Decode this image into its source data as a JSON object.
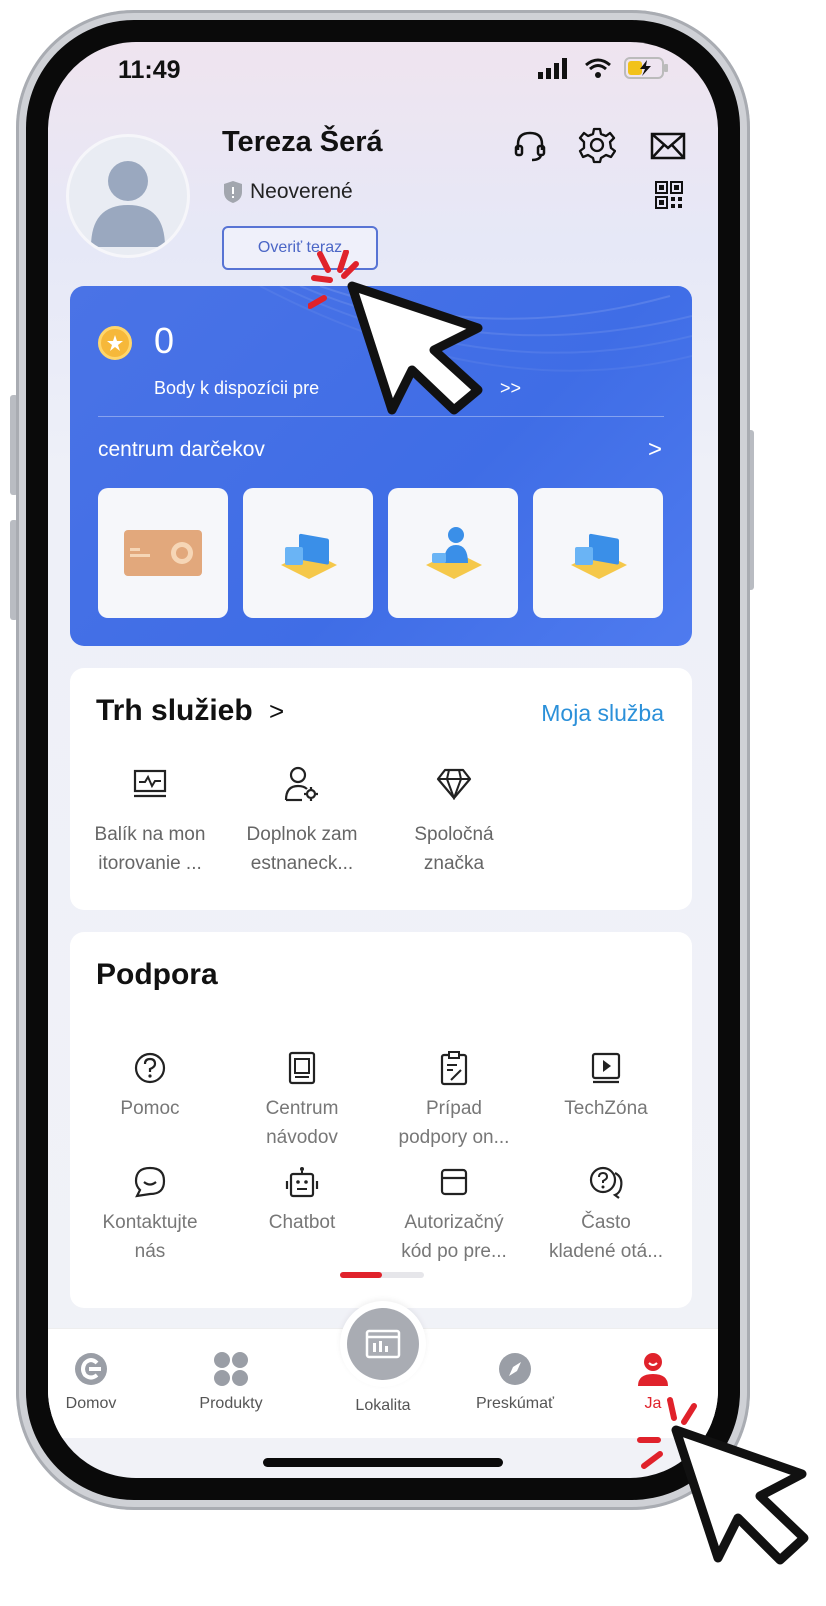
{
  "status_bar": {
    "time": "11:49"
  },
  "profile": {
    "name": "Tereza Šerá",
    "verification_status": "Neoverené",
    "verify_button_label": "Overiť teraz"
  },
  "header_icons": [
    "headset-icon",
    "gear-icon",
    "mail-icon",
    "qr-code-icon"
  ],
  "points": {
    "value": "0",
    "description": "Body k dispozícii pre",
    "more": ">>"
  },
  "gift_center": {
    "title": "centrum darčekov",
    "chevron": ">",
    "tiles": [
      "gift-card-image",
      "device-package-image",
      "person-package-image",
      "device-package-image"
    ]
  },
  "service_market": {
    "title": "Trh služieb",
    "title_chevron": ">",
    "link": "Moja služba",
    "items": [
      {
        "icon": "monitor-chart-icon",
        "line1": "Balík na mon",
        "line2": "itorovanie ..."
      },
      {
        "icon": "user-gear-icon",
        "line1": "Doplnok zam",
        "line2": "estnaneck..."
      },
      {
        "icon": "diamond-icon",
        "line1": "Spoločná",
        "line2": "značka"
      }
    ]
  },
  "support": {
    "title": "Podpora",
    "items": [
      {
        "icon": "question-circle-icon",
        "line1": "Pomoc",
        "line2": ""
      },
      {
        "icon": "book-icon",
        "line1": "Centrum",
        "line2": "návodov"
      },
      {
        "icon": "clipboard-icon",
        "line1": "Prípad",
        "line2": "podpory on..."
      },
      {
        "icon": "play-document-icon",
        "line1": "TechZóna",
        "line2": ""
      },
      {
        "icon": "chat-bubble-icon",
        "line1": "Kontaktujte",
        "line2": "nás"
      },
      {
        "icon": "robot-icon",
        "line1": "Chatbot",
        "line2": ""
      },
      {
        "icon": "archive-box-icon",
        "line1": "Autorizačný",
        "line2": "kód po pre..."
      },
      {
        "icon": "faq-bubbles-icon",
        "line1": "Často",
        "line2": "kladené otá..."
      }
    ]
  },
  "bottom_nav": {
    "items": [
      {
        "icon": "home-logo-icon",
        "label": "Domov"
      },
      {
        "icon": "grid-icon",
        "label": "Produkty"
      },
      {
        "icon": "site-icon",
        "label": "Lokalita"
      },
      {
        "icon": "compass-icon",
        "label": "Preskúmať"
      },
      {
        "icon": "person-icon",
        "label": "Ja"
      }
    ],
    "active": "Ja"
  },
  "colors": {
    "accent_blue": "#4a73e6",
    "active_red": "#e0222b",
    "link_blue": "#2b90d9"
  }
}
